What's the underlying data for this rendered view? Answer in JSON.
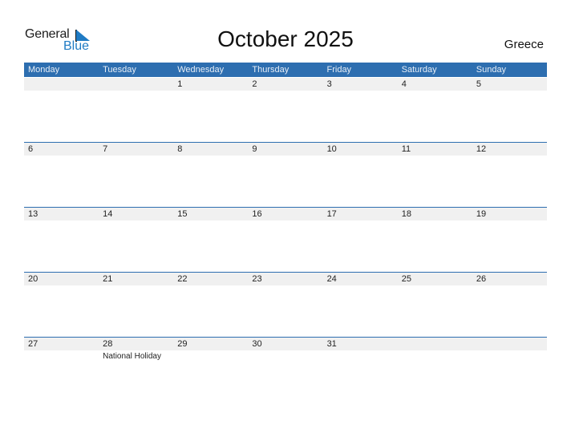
{
  "logo": {
    "word1": "General",
    "word2": "Blue",
    "icon": "triangle-flag-icon"
  },
  "title": "October 2025",
  "country": "Greece",
  "colors": {
    "accent": "#2d6eb0",
    "strip": "#f0f0f0",
    "logo_blue": "#1f7bc4"
  },
  "weekdays": [
    "Monday",
    "Tuesday",
    "Wednesday",
    "Thursday",
    "Friday",
    "Saturday",
    "Sunday"
  ],
  "weeks": [
    [
      "",
      "",
      "1",
      "2",
      "3",
      "4",
      "5"
    ],
    [
      "6",
      "7",
      "8",
      "9",
      "10",
      "11",
      "12"
    ],
    [
      "13",
      "14",
      "15",
      "16",
      "17",
      "18",
      "19"
    ],
    [
      "20",
      "21",
      "22",
      "23",
      "24",
      "25",
      "26"
    ],
    [
      "27",
      "28",
      "29",
      "30",
      "31",
      "",
      ""
    ]
  ],
  "events": [
    {
      "week": 4,
      "day": 1,
      "label": "National Holiday"
    }
  ]
}
